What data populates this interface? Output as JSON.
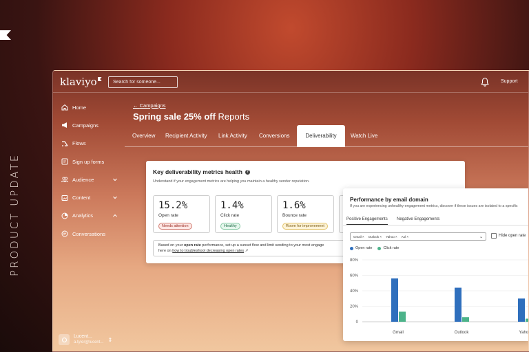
{
  "overlay": {
    "side_text": "PRODUCT UPDATE"
  },
  "topbar": {
    "logo": "klaviyo",
    "search_placeholder": "Search for someone...",
    "support": "Support"
  },
  "nav": {
    "items": [
      {
        "label": "Home",
        "icon": "home-icon"
      },
      {
        "label": "Campaigns",
        "icon": "megaphone-icon"
      },
      {
        "label": "Flows",
        "icon": "flows-icon"
      },
      {
        "label": "Sign up forms",
        "icon": "form-icon"
      },
      {
        "label": "Audience",
        "icon": "audience-icon"
      },
      {
        "label": "Content",
        "icon": "content-icon"
      },
      {
        "label": "Analytics",
        "icon": "analytics-icon"
      },
      {
        "label": "Conversations",
        "icon": "chat-icon"
      }
    ]
  },
  "account": {
    "name": "Lucent...",
    "email": "a.tyler@lucent..."
  },
  "header": {
    "breadcrumb": "Campaigns",
    "title_bold": "Spring sale 25% off",
    "title_rest": "Reports"
  },
  "tabs": [
    "Overview",
    "Recipient Activity",
    "Link Activity",
    "Conversions",
    "Deliverability",
    "Watch Live"
  ],
  "metrics_card": {
    "title": "Key deliverability metrics health",
    "subtitle": "Understand if your engagement metrics are helping you maintain a healthy sender reputation.",
    "metrics": [
      {
        "value": "15.2%",
        "label": "Open rate",
        "badge": "Needs attention"
      },
      {
        "value": "1.4%",
        "label": "Click rate",
        "badge": "Healthy"
      },
      {
        "value": "1.6%",
        "label": "Bounce rate",
        "badge": "Room for improvement"
      }
    ],
    "tip_1": "Based on your",
    "tip_bold": "open rate",
    "tip_2": "performance, set up a sunset flow and limit sending to your most engage",
    "tip_3": "here on",
    "tip_link": "how to troubleshoot decreasing open rates"
  },
  "domain_card": {
    "title": "Performance by email domain",
    "subtitle": "If you are experiencing unhealthy engagement metrics, discover if these issues are isolated to a specific",
    "tabs": [
      "Positive Engagements",
      "Negative Engagements"
    ],
    "chips": [
      "Gmail",
      "Outlook",
      "Yahoo",
      "Aol"
    ],
    "hide_label": "Hide open rate"
  },
  "chart_data": {
    "type": "bar",
    "categories": [
      "Gmail",
      "Outlook",
      "Yahoo"
    ],
    "series": [
      {
        "name": "Open rate",
        "values": [
          56,
          44,
          30
        ],
        "color": "#2f6fbd"
      },
      {
        "name": "Click rate",
        "values": [
          13,
          6,
          4
        ],
        "color": "#4cb38a"
      }
    ],
    "y_ticks": [
      "80%",
      "60%",
      "40%",
      "20%",
      "0"
    ],
    "ylim": [
      0,
      80
    ],
    "grid": true,
    "legend": "top-left"
  }
}
